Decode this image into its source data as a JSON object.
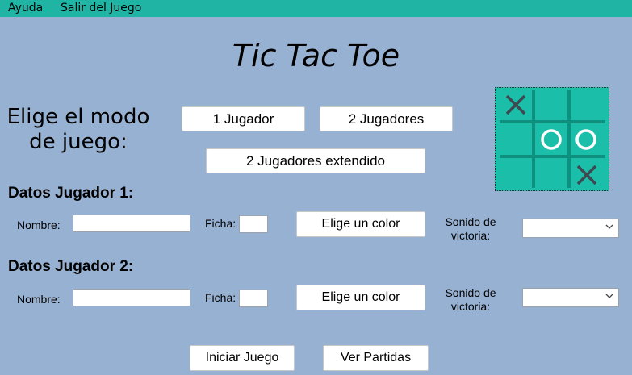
{
  "menu": {
    "help": "Ayuda",
    "exit": "Salir del Juego"
  },
  "title": "Tic Tac Toe",
  "mode": {
    "label_line1": "Elige el modo",
    "label_line2": "de juego:",
    "one_player": "1 Jugador",
    "two_players": "2 Jugadores",
    "two_players_extended": "2 Jugadores extendido"
  },
  "player1": {
    "heading": "Datos Jugador 1:",
    "name_label": "Nombre:",
    "name_value": "",
    "token_label": "Ficha:",
    "token_value": "",
    "color_button": "Elige un color",
    "sound_label_line1": "Sonido de",
    "sound_label_line2": "victoria:",
    "sound_value": ""
  },
  "player2": {
    "heading": "Datos Jugador 2:",
    "name_label": "Nombre:",
    "name_value": "",
    "token_label": "Ficha:",
    "token_value": "",
    "color_button": "Elige un color",
    "sound_label_line1": "Sonido de",
    "sound_label_line2": "victoria:",
    "sound_value": ""
  },
  "actions": {
    "start": "Iniciar Juego",
    "view_games": "Ver Partidas"
  },
  "board_preview": {
    "cells": [
      "X",
      "",
      "",
      "",
      "O",
      "O",
      "",
      "",
      "X"
    ],
    "background_color": "#1bbfa9",
    "line_color": "#0f8f7d",
    "x_color": "#3d4a52",
    "o_color": "#ffffff"
  },
  "colors": {
    "background": "#97b1d2",
    "menubar": "#1fb4a4"
  }
}
